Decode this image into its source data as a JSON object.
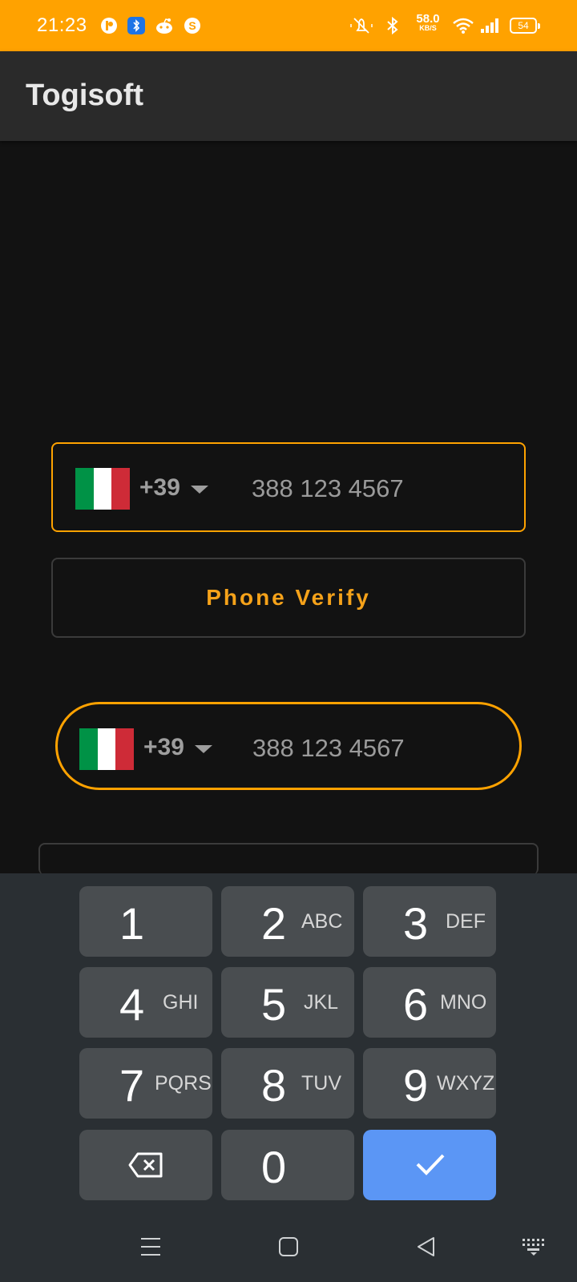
{
  "status_bar": {
    "time": "21:23",
    "net_speed_value": "58.0",
    "net_speed_unit": "KB/S",
    "battery": "54",
    "icons": [
      "notification-app-icon",
      "bluetooth-app-icon",
      "reddit-icon",
      "s-app-icon",
      "mute-icon",
      "bluetooth-icon",
      "wifi-icon",
      "signal-icon",
      "battery-icon"
    ]
  },
  "app_bar": {
    "title": "Togisoft"
  },
  "phone_field_1": {
    "country_code": "+39",
    "placeholder": "388 123 4567",
    "flag": "italy-flag"
  },
  "verify_button": {
    "label": "Phone Verify"
  },
  "phone_field_2": {
    "country_code": "+39",
    "placeholder": "388 123 4567",
    "flag": "italy-flag"
  },
  "keyboard": {
    "keys": [
      {
        "digit": "1",
        "letters": ""
      },
      {
        "digit": "2",
        "letters": "ABC"
      },
      {
        "digit": "3",
        "letters": "DEF"
      },
      {
        "digit": "4",
        "letters": "GHI"
      },
      {
        "digit": "5",
        "letters": "JKL"
      },
      {
        "digit": "6",
        "letters": "MNO"
      },
      {
        "digit": "7",
        "letters": "PQRS"
      },
      {
        "digit": "8",
        "letters": "TUV"
      },
      {
        "digit": "9",
        "letters": "WXYZ"
      },
      {
        "digit": "0",
        "letters": ""
      }
    ]
  },
  "colors": {
    "accent": "#ffa200",
    "background": "#121212",
    "appbar": "#2a2a2a",
    "key": "#494d50",
    "key_ok": "#5b96f5",
    "verify_text": "#f5a21a"
  }
}
